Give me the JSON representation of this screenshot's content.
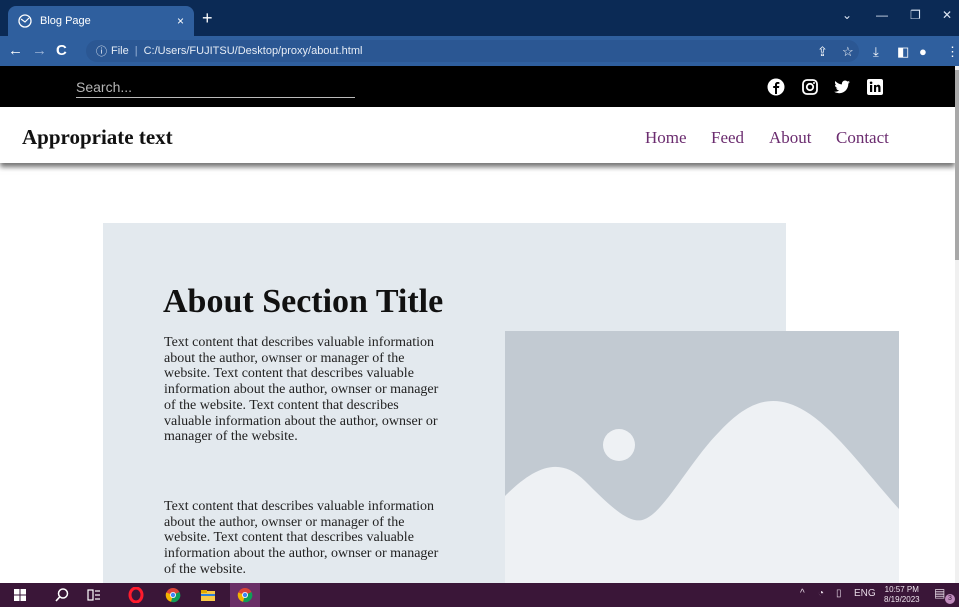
{
  "browser": {
    "tab_title": "Blog Page",
    "tab_close": "×",
    "new_tab": "+",
    "url_prefix": "File",
    "url": "C:/Users/FUJITSU/Desktop/proxy/about.html",
    "icons": [
      "back-icon",
      "forward-icon",
      "reload-icon",
      "info-icon",
      "share-icon",
      "star-icon",
      "download-icon",
      "sidepanel-icon",
      "profile-icon",
      "menu-icon"
    ]
  },
  "page": {
    "search_placeholder": "Search...",
    "brand": "Appropriate text",
    "nav": [
      "Home",
      "Feed",
      "About",
      "Contact"
    ],
    "social_icons": [
      "facebook-icon",
      "instagram-icon",
      "twitter-icon",
      "linkedin-icon"
    ],
    "about": {
      "title": "About Section Title",
      "paragraphs": [
        "Text content that describes valuable information about the author, ownser or manager of the website. Text content that describes valuable information about the author, ownser or manager of the website. Text content that describes valuable information about the author, ownser or manager of the website.",
        "Text content that describes valuable information about the author, ownser or manager of the website. Text content that describes valuable information about the author, ownser or manager of the website."
      ]
    }
  },
  "taskbar": {
    "lang": "ENG",
    "time": "10:57 PM",
    "date": "8/19/2023",
    "notifications": "3"
  },
  "colors": {
    "tabstrip": "#0b2a55",
    "toolbar": "#2f5f9e",
    "nav_link": "#6b2c6f",
    "about_bg": "#e3e9ee",
    "image_placeholder": "#c2cad2",
    "taskbar": "#3a1638"
  }
}
